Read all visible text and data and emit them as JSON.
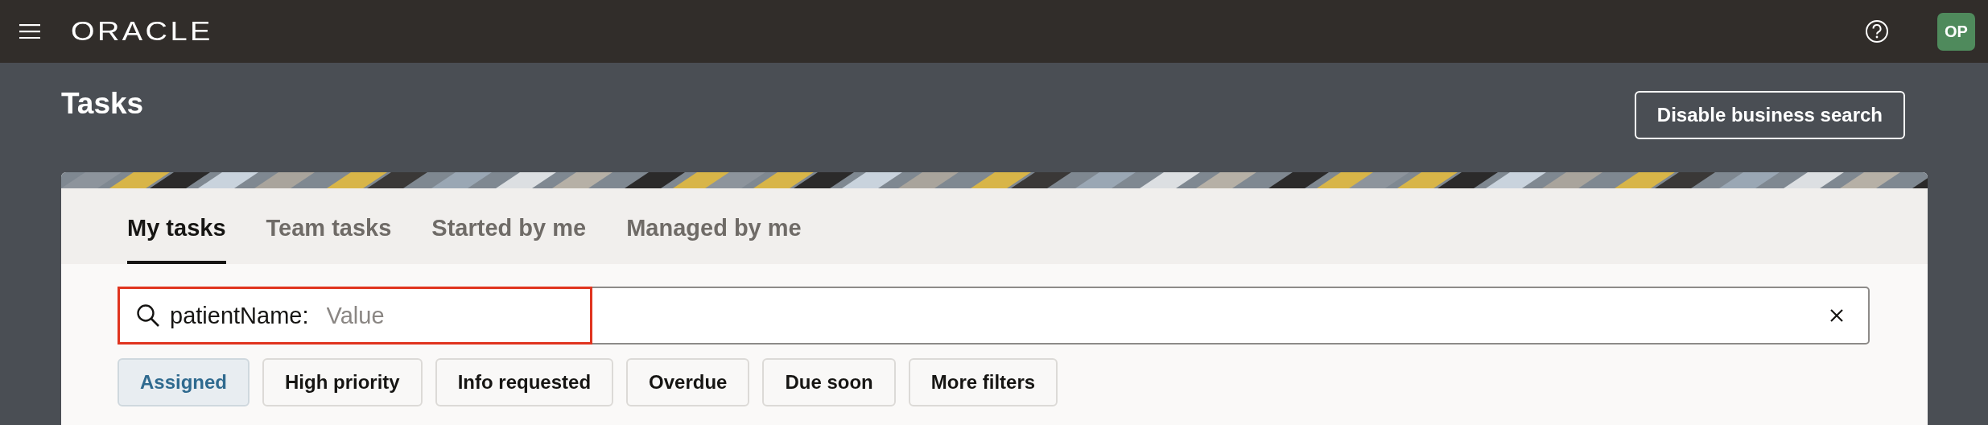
{
  "header": {
    "logo": "ORACLE",
    "avatar": "OP"
  },
  "page": {
    "title": "Tasks",
    "action": "Disable business search"
  },
  "tabs": [
    {
      "label": "My tasks",
      "selected": true
    },
    {
      "label": "Team tasks",
      "selected": false
    },
    {
      "label": "Started by me",
      "selected": false
    },
    {
      "label": "Managed by me",
      "selected": false
    }
  ],
  "search": {
    "filter_label": "patientName:",
    "placeholder": "Value"
  },
  "chips": [
    {
      "label": "Assigned",
      "selected": true
    },
    {
      "label": "High priority",
      "selected": false
    },
    {
      "label": "Info requested",
      "selected": false
    },
    {
      "label": "Overdue",
      "selected": false
    },
    {
      "label": "Due soon",
      "selected": false
    },
    {
      "label": "More filters",
      "selected": false
    }
  ]
}
